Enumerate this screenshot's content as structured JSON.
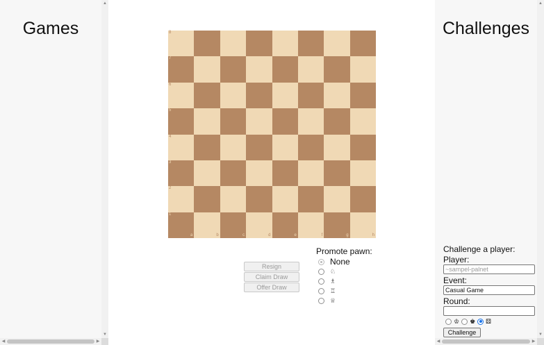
{
  "left_panel": {
    "title": "Games"
  },
  "right_panel": {
    "title": "Challenges"
  },
  "board": {
    "ranks": [
      "8",
      "7",
      "6",
      "5",
      "4",
      "3",
      "2",
      "1"
    ],
    "files": [
      "a",
      "b",
      "c",
      "d",
      "e",
      "f",
      "g",
      "h"
    ],
    "colors": {
      "light": "#f0d9b5",
      "dark": "#b58863"
    }
  },
  "actions": {
    "resign": "Resign",
    "claim_draw": "Claim Draw",
    "offer_draw": "Offer Draw"
  },
  "promote": {
    "label": "Promote pawn:",
    "options": [
      {
        "text": "None",
        "icon": "none"
      },
      {
        "text": "",
        "icon": "knight-icon"
      },
      {
        "text": "",
        "icon": "bishop-icon"
      },
      {
        "text": "",
        "icon": "rook-icon"
      },
      {
        "text": "",
        "icon": "queen-icon"
      }
    ],
    "selected": "None"
  },
  "challenge": {
    "heading": "Challenge a player:",
    "player_label": "Player:",
    "player_placeholder": "~sampel-palnet",
    "event_label": "Event:",
    "event_value": "Casual Game",
    "round_label": "Round:",
    "round_value": "",
    "color_selected": "random",
    "button": "Challenge"
  }
}
